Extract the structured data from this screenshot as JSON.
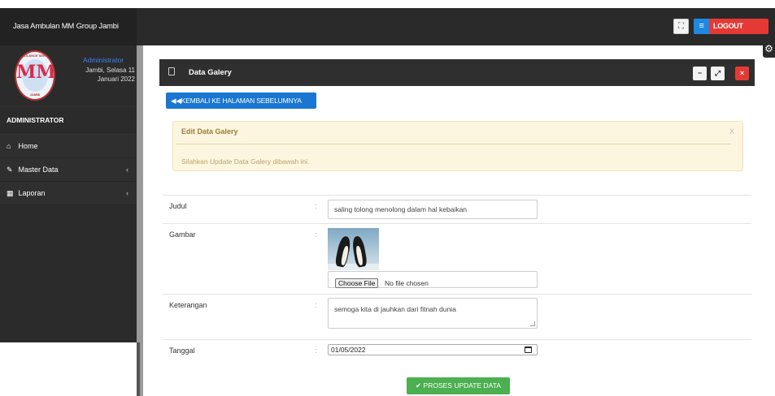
{
  "header": {
    "brand": "Jasa Ambulan MM Group Jambi",
    "fullscreen_icon": "expand-icon",
    "logout_label": "LOGOUT",
    "menu_icon": "hamburger-icon",
    "logout_color": "#e53935",
    "menu_color": "#1e88e5"
  },
  "sidebar": {
    "logo_ring_text": "AMBULANCE SERVICE",
    "logo_letters": "MM",
    "logo_bottom_text": "JAMBI",
    "user_role_label": "Administrator",
    "user_date": "Jambi, Selasa 11 Januari 2022",
    "section_title": "ADMINISTRATOR",
    "items": [
      {
        "label": "Home",
        "icon": "home-icon",
        "glyph": "⌂",
        "has_arrow": false
      },
      {
        "label": "Master Data",
        "icon": "edit-icon",
        "glyph": "✎",
        "has_arrow": true
      },
      {
        "label": "Laporan",
        "icon": "calendar-icon",
        "glyph": "▦",
        "has_arrow": true
      }
    ],
    "arrow": "‹"
  },
  "panel": {
    "title": "Data Galery",
    "min_label": "−",
    "max_label": "⤢",
    "close_label": "×"
  },
  "back_button": "◀◀KEMBALI KE HALAMAN SEBELUMNYA",
  "alert": {
    "title": "Edit Data Galery",
    "close": "X",
    "message": "Silahkan Update Data Galery dibawah ini."
  },
  "form": {
    "colon": ":",
    "judul": {
      "label": "Judul",
      "value": "saling tolong menolong dalam hal kebaikan"
    },
    "gambar": {
      "label": "Gambar",
      "file_button": "Choose File",
      "file_status": "No file chosen"
    },
    "keterangan": {
      "label": "Keterangan",
      "value": "semoga kita di jauhkan dari fitnah dunia"
    },
    "tanggal": {
      "label": "Tanggal",
      "value": "01/05/2022"
    },
    "submit": "✔ PROSES UPDATE DATA"
  }
}
